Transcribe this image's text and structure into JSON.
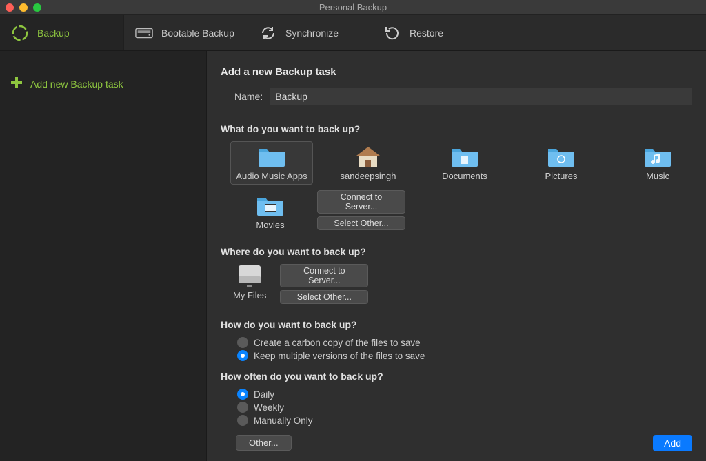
{
  "window": {
    "title": "Personal Backup"
  },
  "toolbar": {
    "backup": "Backup",
    "bootable": "Bootable Backup",
    "synchronize": "Synchronize",
    "restore": "Restore"
  },
  "sidebar": {
    "add_task": "Add new Backup task"
  },
  "main": {
    "heading": "Add a new Backup task",
    "name_label": "Name:",
    "name_value": "Backup",
    "section_what": "What do you want to back up?",
    "sources": {
      "audio": "Audio Music Apps",
      "home": "sandeepsingh",
      "documents": "Documents",
      "pictures": "Pictures",
      "music": "Music",
      "movies": "Movies"
    },
    "connect_server": "Connect to Server...",
    "select_other": "Select Other...",
    "section_where": "Where do you want to back up?",
    "destination": {
      "myfiles": "My Files"
    },
    "section_how": "How do you want to back up?",
    "how": {
      "carbon": "Create a carbon copy of the files to save",
      "versions": "Keep multiple versions of the files to save"
    },
    "section_when": "How often do you want to back up?",
    "when": {
      "daily": "Daily",
      "weekly": "Weekly",
      "manually": "Manually Only"
    },
    "other_btn": "Other...",
    "add_btn": "Add"
  }
}
